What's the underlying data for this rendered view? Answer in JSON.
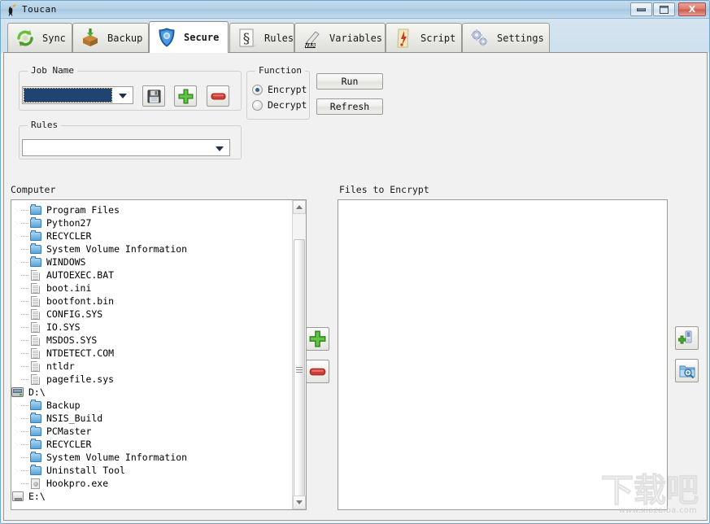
{
  "window": {
    "title": "Toucan",
    "icon": "toucan-icon",
    "buttons": {
      "minimize": "minimize-button",
      "maximize": "maximize-button",
      "close_label": "X"
    }
  },
  "tabs": [
    {
      "label": "Sync",
      "icon": "sync-arrows-icon",
      "active": false
    },
    {
      "label": "Backup",
      "icon": "backup-box-icon",
      "active": false
    },
    {
      "label": "Secure",
      "icon": "shield-icon",
      "active": true
    },
    {
      "label": "Rules",
      "icon": "paragraph-icon",
      "active": false
    },
    {
      "label": "Variables",
      "icon": "variables-pen-icon",
      "active": false
    },
    {
      "label": "Script",
      "icon": "script-scroll-icon",
      "active": false
    },
    {
      "label": "Settings",
      "icon": "gears-icon",
      "active": false
    }
  ],
  "job_name": {
    "group_title": "Job Name",
    "combo_value": "",
    "save_button": "save-icon",
    "add_button": "add-icon",
    "remove_button": "remove-icon"
  },
  "function": {
    "group_title": "Function",
    "options": [
      {
        "label": "Encrypt",
        "checked": true
      },
      {
        "label": "Decrypt",
        "checked": false
      }
    ]
  },
  "actions": {
    "run_label": "Run",
    "refresh_label": "Refresh"
  },
  "rules": {
    "group_title": "Rules",
    "combo_value": ""
  },
  "panels": {
    "left_label": "Computer",
    "right_label": "Files to Encrypt"
  },
  "transfer_buttons": {
    "add": "add-green-plus-icon",
    "remove": "remove-red-minus-icon"
  },
  "right_buttons": {
    "add_file": "add-file-icon",
    "browse_folder": "browse-folder-icon"
  },
  "tree": [
    {
      "label": "Program Files",
      "type": "folder",
      "depth": 1,
      "expandable": true
    },
    {
      "label": "Python27",
      "type": "folder",
      "depth": 1,
      "expandable": true
    },
    {
      "label": "RECYCLER",
      "type": "folder",
      "depth": 1,
      "expandable": true
    },
    {
      "label": "System Volume Information",
      "type": "folder",
      "depth": 1,
      "expandable": false
    },
    {
      "label": "WINDOWS",
      "type": "folder",
      "depth": 1,
      "expandable": true
    },
    {
      "label": "AUTOEXEC.BAT",
      "type": "file",
      "depth": 1,
      "expandable": false
    },
    {
      "label": "boot.ini",
      "type": "file",
      "depth": 1,
      "expandable": false
    },
    {
      "label": "bootfont.bin",
      "type": "file",
      "depth": 1,
      "expandable": false
    },
    {
      "label": "CONFIG.SYS",
      "type": "file",
      "depth": 1,
      "expandable": false
    },
    {
      "label": "IO.SYS",
      "type": "file",
      "depth": 1,
      "expandable": false
    },
    {
      "label": "MSDOS.SYS",
      "type": "file",
      "depth": 1,
      "expandable": false
    },
    {
      "label": "NTDETECT.COM",
      "type": "file",
      "depth": 1,
      "expandable": false
    },
    {
      "label": "ntldr",
      "type": "file",
      "depth": 1,
      "expandable": false
    },
    {
      "label": "pagefile.sys",
      "type": "file",
      "depth": 1,
      "expandable": false
    },
    {
      "label": "D:\\",
      "type": "hdd",
      "depth": 0,
      "expandable": false
    },
    {
      "label": "Backup",
      "type": "folder",
      "depth": 1,
      "expandable": true
    },
    {
      "label": "NSIS_Build",
      "type": "folder",
      "depth": 1,
      "expandable": true
    },
    {
      "label": "PCMaster",
      "type": "folder",
      "depth": 1,
      "expandable": true
    },
    {
      "label": "RECYCLER",
      "type": "folder",
      "depth": 1,
      "expandable": true
    },
    {
      "label": "System Volume Information",
      "type": "folder",
      "depth": 1,
      "expandable": false
    },
    {
      "label": "Uninstall Tool",
      "type": "folder",
      "depth": 1,
      "expandable": true
    },
    {
      "label": "Hookpro.exe",
      "type": "exe",
      "depth": 1,
      "expandable": false
    },
    {
      "label": "E:\\",
      "type": "rem",
      "depth": 0,
      "expandable": false
    }
  ],
  "file_list": [],
  "watermark": {
    "cn": "下载吧",
    "url": "www.xiazaiba.com"
  },
  "colors": {
    "titlebar": "#b3d0e6",
    "accent": "#1f4472",
    "close": "#c95a4b"
  }
}
